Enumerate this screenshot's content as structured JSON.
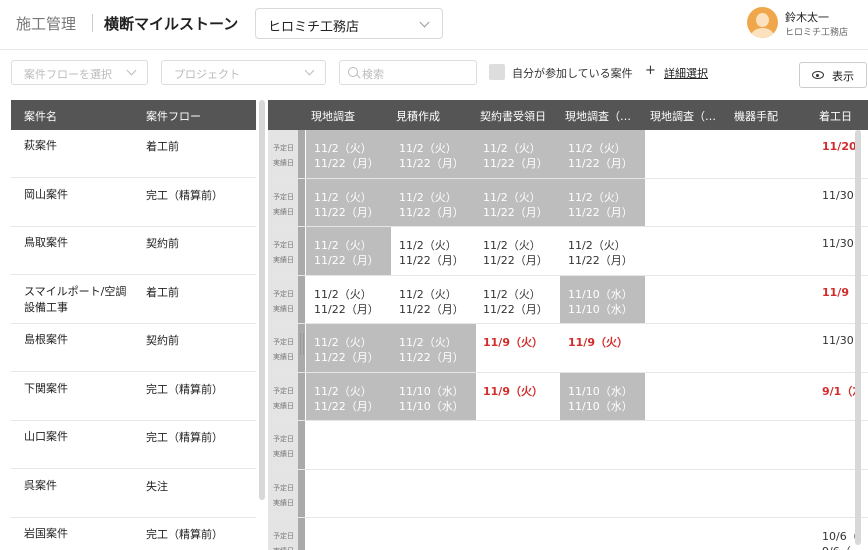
{
  "header": {
    "app_title": "施工管理",
    "page_title": "横断マイルストーン",
    "company": "ヒロミチ工務店",
    "user_name": "鈴木太一",
    "user_company": "ヒロミチ工務店"
  },
  "filters": {
    "flow_placeholder": "案件フローを選択",
    "project_placeholder": "プロジェクト",
    "search_placeholder": "検索",
    "self_only_label": "自分が参加している案件",
    "plus": "+",
    "detail_label": "詳細選択",
    "display_label": "表示"
  },
  "left_table": {
    "columns": [
      "案件名",
      "案件フロー"
    ],
    "rows": [
      {
        "name": "萩案件",
        "flow": "着工前"
      },
      {
        "name": "岡山案件",
        "flow": "完工（精算前）"
      },
      {
        "name": "鳥取案件",
        "flow": "契約前"
      },
      {
        "name": "スマイルポート/空調設備工事",
        "flow": "着工前"
      },
      {
        "name": "島根案件",
        "flow": "契約前"
      },
      {
        "name": "下関案件",
        "flow": "完工（精算前）"
      },
      {
        "name": "山口案件",
        "flow": "完工（精算前）"
      },
      {
        "name": "呉案件",
        "flow": "失注"
      },
      {
        "name": "岩国案件",
        "flow": "完工（精算前）"
      }
    ]
  },
  "grid": {
    "row_labels": [
      "予定日",
      "実績日"
    ],
    "columns": [
      "現地調査",
      "見積作成",
      "契約書受領日",
      "現地調査（…",
      "現地調査（…",
      "機器手配",
      "着工日"
    ],
    "rows": [
      {
        "cells": [
          {
            "p": "11/2（火）",
            "r": "11/22（月）",
            "gray": true
          },
          {
            "p": "11/2（火）",
            "r": "11/22（月）",
            "gray": true
          },
          {
            "p": "11/2（火）",
            "r": "11/22（月）",
            "gray": true
          },
          {
            "p": "11/2（火）",
            "r": "11/22（月）",
            "gray": true
          },
          {},
          {},
          {
            "p": "11/20",
            "red": true
          }
        ]
      },
      {
        "cells": [
          {
            "p": "11/2（火）",
            "r": "11/22（月）",
            "gray": true
          },
          {
            "p": "11/2（火）",
            "r": "11/22（月）",
            "gray": true
          },
          {
            "p": "11/2（火）",
            "r": "11/22（月）",
            "gray": true
          },
          {
            "p": "11/2（火）",
            "r": "11/22（月）",
            "gray": true
          },
          {},
          {},
          {
            "p": "11/30"
          }
        ]
      },
      {
        "cells": [
          {
            "p": "11/2（火）",
            "r": "11/22（月）",
            "gray": true
          },
          {
            "p": "11/2（火）",
            "r": "11/22（月）"
          },
          {
            "p": "11/2（火）",
            "r": "11/22（月）"
          },
          {
            "p": "11/2（火）",
            "r": "11/22（月）"
          },
          {},
          {},
          {
            "p": "11/30"
          }
        ]
      },
      {
        "cells": [
          {
            "p": "11/2（火）",
            "r": "11/22（月）"
          },
          {
            "p": "11/2（火）",
            "r": "11/22（月）"
          },
          {
            "p": "11/2（火）",
            "r": "11/22（月）"
          },
          {
            "p": "11/10（水）",
            "r": "11/10（水）",
            "gray": true
          },
          {},
          {},
          {
            "p": "11/9",
            "red": true
          }
        ]
      },
      {
        "cells": [
          {
            "p": "11/2（火）",
            "r": "11/22（月）",
            "gray": true
          },
          {
            "p": "11/2（火）",
            "r": "11/22（月）",
            "gray": true
          },
          {
            "p": "11/9（火）",
            "red": true
          },
          {
            "p": "11/9（火）",
            "red": true
          },
          {},
          {},
          {
            "p": "11/30"
          }
        ]
      },
      {
        "cells": [
          {
            "p": "11/2（火）",
            "r": "11/22（月）",
            "gray": true
          },
          {
            "p": "11/10（水）",
            "r": "11/10（水）",
            "gray": true
          },
          {
            "p": "11/9（火）",
            "red": true
          },
          {
            "p": "11/10（水）",
            "r": "11/10（水）",
            "gray": true
          },
          {},
          {},
          {
            "p": "9/1（ｽ",
            "red": true
          }
        ]
      },
      {
        "cells": [
          {},
          {},
          {},
          {},
          {},
          {},
          {}
        ]
      },
      {
        "cells": [
          {},
          {},
          {},
          {},
          {},
          {},
          {}
        ]
      },
      {
        "cells": [
          {},
          {},
          {},
          {},
          {},
          {},
          {
            "p": "10/6（",
            "r": "9/6（"
          }
        ]
      }
    ]
  },
  "colors": {
    "header_bg": "#555555",
    "completed_cell": "#bdbdbd",
    "overdue_text": "#d12d2d",
    "avatar": "#f0a64a"
  }
}
